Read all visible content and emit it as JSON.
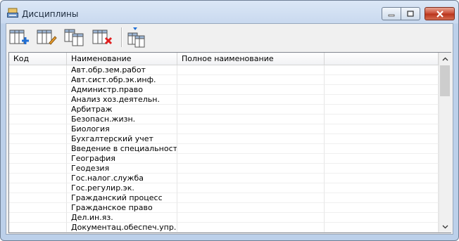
{
  "window": {
    "title": "Дисциплины"
  },
  "toolbar": {
    "buttons": [
      {
        "icon": "add-column-icon"
      },
      {
        "icon": "edit-column-icon"
      },
      {
        "icon": "copy-columns-icon"
      },
      {
        "icon": "delete-column-icon"
      },
      {
        "icon": "sort-columns-icon"
      }
    ]
  },
  "table": {
    "columns": [
      "Код",
      "Наименование",
      "Полное наименование",
      ""
    ],
    "rows": [
      "Авт.обр.зем.работ",
      "Авт.сист.обр.эк.инф.",
      "Администр.право",
      "Анализ хоз.деятельн.",
      "Арбитраж",
      "Безопасн.жизн.",
      "Биология",
      "Бухгалтерский учет",
      "Введение в специальность",
      "География",
      "Геодезия",
      "Гос.налог.служба",
      "Гос.регулир.эк.",
      "Гражданский процесс",
      "Гражданское право",
      "Дел.ин.яз.",
      "Документац.обеспеч.упр."
    ]
  },
  "colors": {
    "titlebar": "#c9d9ef",
    "close_button": "#c94a33",
    "accent_blue": "#1f6fd6",
    "delete_red": "#e02020"
  }
}
